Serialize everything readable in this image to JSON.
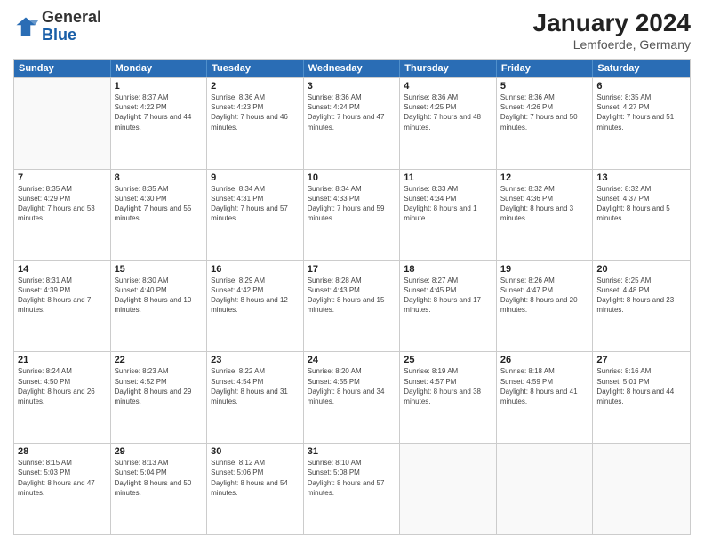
{
  "header": {
    "logo": {
      "general": "General",
      "blue": "Blue"
    },
    "title": "January 2024",
    "subtitle": "Lemfoerde, Germany"
  },
  "weekdays": [
    "Sunday",
    "Monday",
    "Tuesday",
    "Wednesday",
    "Thursday",
    "Friday",
    "Saturday"
  ],
  "rows": [
    [
      {
        "day": "",
        "sunrise": "",
        "sunset": "",
        "daylight": "",
        "empty": true
      },
      {
        "day": "1",
        "sunrise": "Sunrise: 8:37 AM",
        "sunset": "Sunset: 4:22 PM",
        "daylight": "Daylight: 7 hours and 44 minutes."
      },
      {
        "day": "2",
        "sunrise": "Sunrise: 8:36 AM",
        "sunset": "Sunset: 4:23 PM",
        "daylight": "Daylight: 7 hours and 46 minutes."
      },
      {
        "day": "3",
        "sunrise": "Sunrise: 8:36 AM",
        "sunset": "Sunset: 4:24 PM",
        "daylight": "Daylight: 7 hours and 47 minutes."
      },
      {
        "day": "4",
        "sunrise": "Sunrise: 8:36 AM",
        "sunset": "Sunset: 4:25 PM",
        "daylight": "Daylight: 7 hours and 48 minutes."
      },
      {
        "day": "5",
        "sunrise": "Sunrise: 8:36 AM",
        "sunset": "Sunset: 4:26 PM",
        "daylight": "Daylight: 7 hours and 50 minutes."
      },
      {
        "day": "6",
        "sunrise": "Sunrise: 8:35 AM",
        "sunset": "Sunset: 4:27 PM",
        "daylight": "Daylight: 7 hours and 51 minutes."
      }
    ],
    [
      {
        "day": "7",
        "sunrise": "Sunrise: 8:35 AM",
        "sunset": "Sunset: 4:29 PM",
        "daylight": "Daylight: 7 hours and 53 minutes."
      },
      {
        "day": "8",
        "sunrise": "Sunrise: 8:35 AM",
        "sunset": "Sunset: 4:30 PM",
        "daylight": "Daylight: 7 hours and 55 minutes."
      },
      {
        "day": "9",
        "sunrise": "Sunrise: 8:34 AM",
        "sunset": "Sunset: 4:31 PM",
        "daylight": "Daylight: 7 hours and 57 minutes."
      },
      {
        "day": "10",
        "sunrise": "Sunrise: 8:34 AM",
        "sunset": "Sunset: 4:33 PM",
        "daylight": "Daylight: 7 hours and 59 minutes."
      },
      {
        "day": "11",
        "sunrise": "Sunrise: 8:33 AM",
        "sunset": "Sunset: 4:34 PM",
        "daylight": "Daylight: 8 hours and 1 minute."
      },
      {
        "day": "12",
        "sunrise": "Sunrise: 8:32 AM",
        "sunset": "Sunset: 4:36 PM",
        "daylight": "Daylight: 8 hours and 3 minutes."
      },
      {
        "day": "13",
        "sunrise": "Sunrise: 8:32 AM",
        "sunset": "Sunset: 4:37 PM",
        "daylight": "Daylight: 8 hours and 5 minutes."
      }
    ],
    [
      {
        "day": "14",
        "sunrise": "Sunrise: 8:31 AM",
        "sunset": "Sunset: 4:39 PM",
        "daylight": "Daylight: 8 hours and 7 minutes."
      },
      {
        "day": "15",
        "sunrise": "Sunrise: 8:30 AM",
        "sunset": "Sunset: 4:40 PM",
        "daylight": "Daylight: 8 hours and 10 minutes."
      },
      {
        "day": "16",
        "sunrise": "Sunrise: 8:29 AM",
        "sunset": "Sunset: 4:42 PM",
        "daylight": "Daylight: 8 hours and 12 minutes."
      },
      {
        "day": "17",
        "sunrise": "Sunrise: 8:28 AM",
        "sunset": "Sunset: 4:43 PM",
        "daylight": "Daylight: 8 hours and 15 minutes."
      },
      {
        "day": "18",
        "sunrise": "Sunrise: 8:27 AM",
        "sunset": "Sunset: 4:45 PM",
        "daylight": "Daylight: 8 hours and 17 minutes."
      },
      {
        "day": "19",
        "sunrise": "Sunrise: 8:26 AM",
        "sunset": "Sunset: 4:47 PM",
        "daylight": "Daylight: 8 hours and 20 minutes."
      },
      {
        "day": "20",
        "sunrise": "Sunrise: 8:25 AM",
        "sunset": "Sunset: 4:48 PM",
        "daylight": "Daylight: 8 hours and 23 minutes."
      }
    ],
    [
      {
        "day": "21",
        "sunrise": "Sunrise: 8:24 AM",
        "sunset": "Sunset: 4:50 PM",
        "daylight": "Daylight: 8 hours and 26 minutes."
      },
      {
        "day": "22",
        "sunrise": "Sunrise: 8:23 AM",
        "sunset": "Sunset: 4:52 PM",
        "daylight": "Daylight: 8 hours and 29 minutes."
      },
      {
        "day": "23",
        "sunrise": "Sunrise: 8:22 AM",
        "sunset": "Sunset: 4:54 PM",
        "daylight": "Daylight: 8 hours and 31 minutes."
      },
      {
        "day": "24",
        "sunrise": "Sunrise: 8:20 AM",
        "sunset": "Sunset: 4:55 PM",
        "daylight": "Daylight: 8 hours and 34 minutes."
      },
      {
        "day": "25",
        "sunrise": "Sunrise: 8:19 AM",
        "sunset": "Sunset: 4:57 PM",
        "daylight": "Daylight: 8 hours and 38 minutes."
      },
      {
        "day": "26",
        "sunrise": "Sunrise: 8:18 AM",
        "sunset": "Sunset: 4:59 PM",
        "daylight": "Daylight: 8 hours and 41 minutes."
      },
      {
        "day": "27",
        "sunrise": "Sunrise: 8:16 AM",
        "sunset": "Sunset: 5:01 PM",
        "daylight": "Daylight: 8 hours and 44 minutes."
      }
    ],
    [
      {
        "day": "28",
        "sunrise": "Sunrise: 8:15 AM",
        "sunset": "Sunset: 5:03 PM",
        "daylight": "Daylight: 8 hours and 47 minutes."
      },
      {
        "day": "29",
        "sunrise": "Sunrise: 8:13 AM",
        "sunset": "Sunset: 5:04 PM",
        "daylight": "Daylight: 8 hours and 50 minutes."
      },
      {
        "day": "30",
        "sunrise": "Sunrise: 8:12 AM",
        "sunset": "Sunset: 5:06 PM",
        "daylight": "Daylight: 8 hours and 54 minutes."
      },
      {
        "day": "31",
        "sunrise": "Sunrise: 8:10 AM",
        "sunset": "Sunset: 5:08 PM",
        "daylight": "Daylight: 8 hours and 57 minutes."
      },
      {
        "day": "",
        "sunrise": "",
        "sunset": "",
        "daylight": "",
        "empty": true
      },
      {
        "day": "",
        "sunrise": "",
        "sunset": "",
        "daylight": "",
        "empty": true
      },
      {
        "day": "",
        "sunrise": "",
        "sunset": "",
        "daylight": "",
        "empty": true
      }
    ]
  ]
}
